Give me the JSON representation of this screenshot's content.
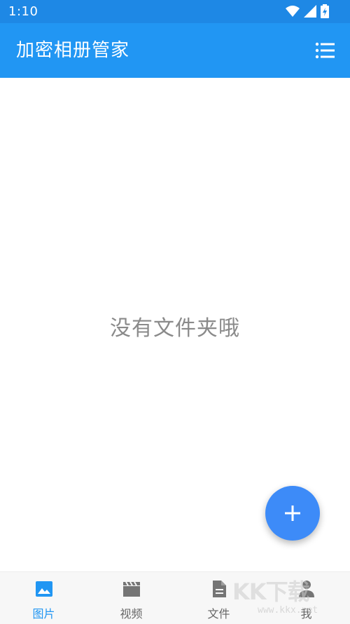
{
  "status_bar": {
    "time": "1:10"
  },
  "app_bar": {
    "title": "加密相册管家",
    "menu_icon": "list-menu-icon"
  },
  "content": {
    "empty_message": "没有文件夹哦"
  },
  "fab": {
    "icon": "plus-icon",
    "color": "#3D8BF8"
  },
  "bottom_nav": {
    "active_color": "#2196F3",
    "items": [
      {
        "label": "图片",
        "icon": "image-icon",
        "active": true
      },
      {
        "label": "视频",
        "icon": "clapperboard-icon",
        "active": false
      },
      {
        "label": "文件",
        "icon": "document-icon",
        "active": false
      },
      {
        "label": "我",
        "icon": "person-icon",
        "active": false
      }
    ]
  },
  "watermark": {
    "brand": "KK下载",
    "url": "www.kkx.net"
  },
  "colors": {
    "status_bar": "#1E88E5",
    "app_bar": "#2196F3",
    "empty_text": "#8a8a8a"
  }
}
